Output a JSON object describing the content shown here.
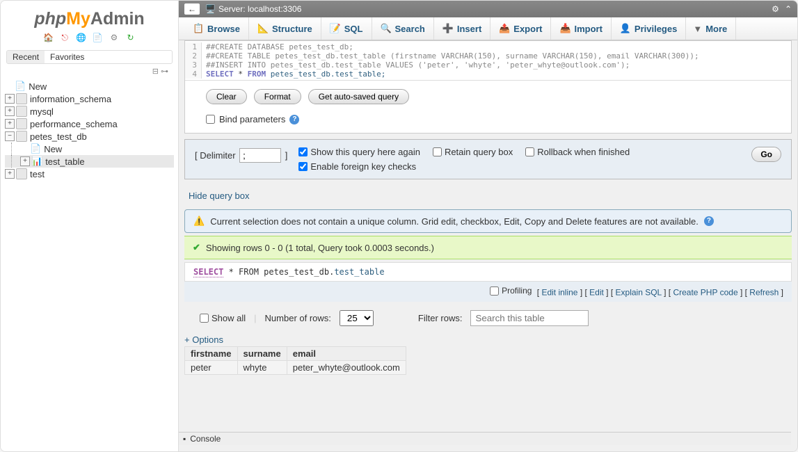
{
  "logo": {
    "php": "php",
    "my": "My",
    "admin": "Admin"
  },
  "sidebar": {
    "tabs": {
      "recent": "Recent",
      "favorites": "Favorites"
    },
    "items": [
      {
        "label": "New",
        "type": "new"
      },
      {
        "label": "information_schema",
        "type": "db"
      },
      {
        "label": "mysql",
        "type": "db"
      },
      {
        "label": "performance_schema",
        "type": "db"
      },
      {
        "label": "petes_test_db",
        "type": "db",
        "expanded": true,
        "children": [
          {
            "label": "New",
            "type": "new"
          },
          {
            "label": "test_table",
            "type": "table",
            "selected": true
          }
        ]
      },
      {
        "label": "test",
        "type": "db"
      }
    ]
  },
  "topbar": {
    "server_label": "Server:",
    "server_value": "localhost:3306"
  },
  "nav": [
    {
      "label": "Browse"
    },
    {
      "label": "Structure"
    },
    {
      "label": "SQL"
    },
    {
      "label": "Search"
    },
    {
      "label": "Insert"
    },
    {
      "label": "Export"
    },
    {
      "label": "Import"
    },
    {
      "label": "Privileges"
    },
    {
      "label": "More",
      "caret": true
    }
  ],
  "sql": {
    "lines": [
      {
        "n": "1",
        "text": "##CREATE DATABASE petes_test_db;",
        "cls": "cm"
      },
      {
        "n": "2",
        "text": "##CREATE TABLE petes_test_db.test_table (firstname VARCHAR(150), surname VARCHAR(150), email VARCHAR(300));",
        "cls": "cm"
      },
      {
        "n": "3",
        "text": "##INSERT INTO petes_test_db.test_table VALUES ('peter', 'whyte', 'peter_whyte@outlook.com');",
        "cls": "cm"
      },
      {
        "n": "4",
        "select": "SELECT",
        "star": " * ",
        "from": "FROM",
        "id": " petes_test_db.test_table;"
      }
    ],
    "clear": "Clear",
    "format": "Format",
    "auto": "Get auto-saved query",
    "bind": "Bind parameters"
  },
  "delim": {
    "label": "Delimiter",
    "value": ";",
    "show_again": "Show this query here again",
    "retain": "Retain query box",
    "rollback": "Rollback when finished",
    "fk": "Enable foreign key checks",
    "go": "Go"
  },
  "hide_link": "Hide query box",
  "notice": {
    "text": "Current selection does not contain a unique column. Grid edit, checkbox, Edit, Copy and Delete features are not available."
  },
  "success": {
    "text": "Showing rows 0 - 0 (1 total, Query took 0.0003 seconds.)"
  },
  "query_display": {
    "select": "SELECT",
    "mid": " * FROM petes_test_db.",
    "tbl": "test_table"
  },
  "actions": {
    "profiling": "Profiling",
    "edit_inline": "Edit inline",
    "edit": "Edit",
    "explain": "Explain SQL",
    "create_php": "Create PHP code",
    "refresh": "Refresh"
  },
  "table_controls": {
    "show_all": "Show all",
    "num_rows_label": "Number of rows:",
    "num_rows_value": "25",
    "filter_label": "Filter rows:",
    "filter_placeholder": "Search this table"
  },
  "options": "+ Options",
  "result": {
    "headers": [
      "firstname",
      "surname",
      "email"
    ],
    "rows": [
      [
        "peter",
        "whyte",
        "peter_whyte@outlook.com"
      ]
    ]
  },
  "console": "Console"
}
